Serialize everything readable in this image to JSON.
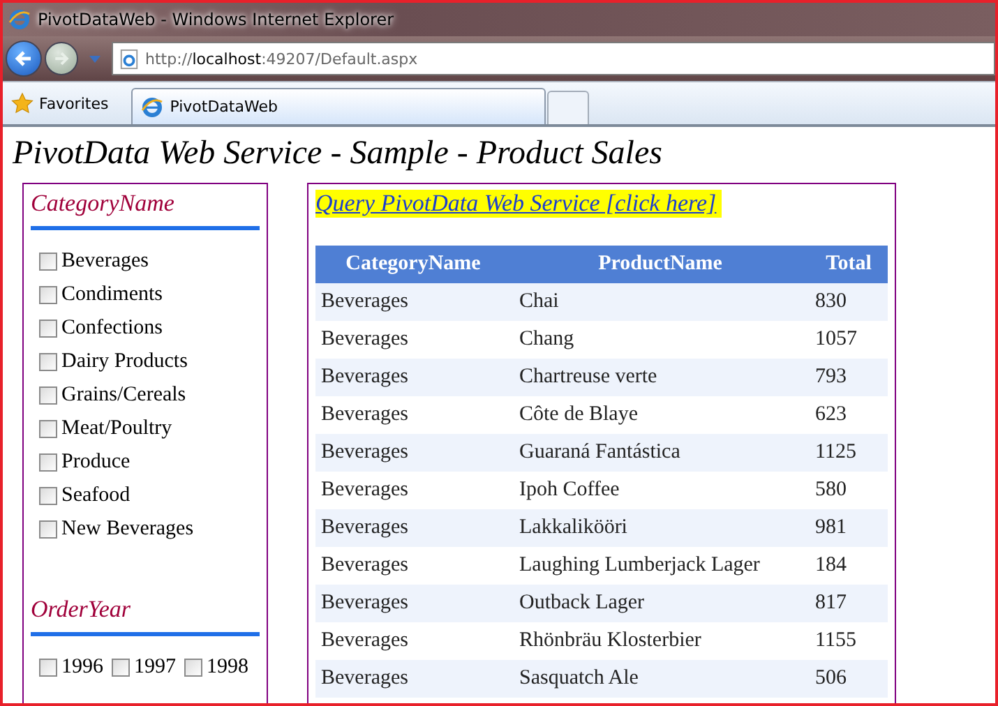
{
  "window": {
    "title": "PivotDataWeb - Windows Internet Explorer"
  },
  "address": {
    "url": "http://**localhost**:49207/Default.aspx"
  },
  "favorites": {
    "label": "Favorites"
  },
  "tabs": [
    {
      "label": "PivotDataWeb",
      "selected": true
    }
  ],
  "heading": "PivotData Web Service - Sample - Product Sales",
  "filters": [
    {
      "title": "CategoryName",
      "kind": "list",
      "options": [
        {
          "label": "Beverages",
          "checked": false
        },
        {
          "label": "Condiments",
          "checked": false
        },
        {
          "label": "Confections",
          "checked": false
        },
        {
          "label": "Dairy Products",
          "checked": false
        },
        {
          "label": "Grains/Cereals",
          "checked": false
        },
        {
          "label": "Meat/Poultry",
          "checked": false
        },
        {
          "label": "Produce",
          "checked": false
        },
        {
          "label": "Seafood",
          "checked": false
        },
        {
          "label": "New Beverages",
          "checked": false
        }
      ]
    },
    {
      "title": "OrderYear",
      "kind": "inline",
      "options": [
        {
          "label": "1996",
          "checked": false
        },
        {
          "label": "1997",
          "checked": false
        },
        {
          "label": "1998",
          "checked": false
        }
      ]
    }
  ],
  "query_link": "Query PivotData Web Service [click here]",
  "table": {
    "columns": [
      "CategoryName",
      "ProductName",
      "Total"
    ],
    "rows": [
      [
        "Beverages",
        "Chai",
        "830"
      ],
      [
        "Beverages",
        "Chang",
        "1057"
      ],
      [
        "Beverages",
        "Chartreuse verte",
        "793"
      ],
      [
        "Beverages",
        "Côte de Blaye",
        "623"
      ],
      [
        "Beverages",
        "Guaraná Fantástica",
        "1125"
      ],
      [
        "Beverages",
        "Ipoh Coffee",
        "580"
      ],
      [
        "Beverages",
        "Lakkalikööri",
        "981"
      ],
      [
        "Beverages",
        "Laughing Lumberjack Lager",
        "184"
      ],
      [
        "Beverages",
        "Outback Lager",
        "817"
      ],
      [
        "Beverages",
        "Rhönbräu Klosterbier",
        "1155"
      ],
      [
        "Beverages",
        "Sasquatch Ale",
        "506"
      ]
    ]
  }
}
